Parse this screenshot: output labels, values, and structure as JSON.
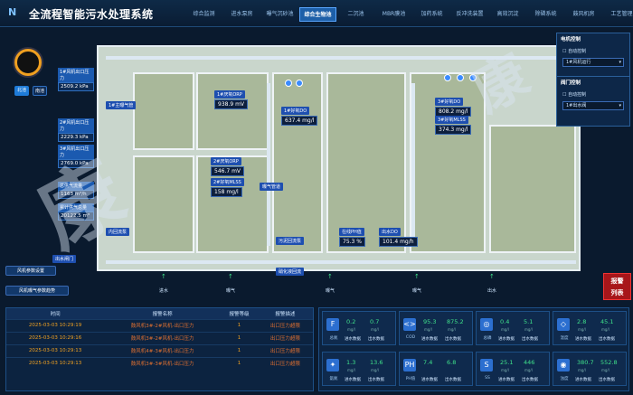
{
  "header": {
    "title": "全流程智能污水处理系统"
  },
  "tabs": [
    "综合监测",
    "进水泵房",
    "曝气沉砂池",
    "综合生物池",
    "二沉池",
    "MBR膜池",
    "加药系统",
    "反冲洗装置",
    "高效沉淀",
    "除磷系统",
    "鼓风机房",
    "工艺管理"
  ],
  "active_tab": 3,
  "gauge_labels": {
    "north": "北池",
    "south": "南池"
  },
  "left_readouts": [
    {
      "key": "1#风机出口压力",
      "value": "2509.2 kPa"
    },
    {
      "key": "2#风机出口压力",
      "value": "2229.3 kPa"
    },
    {
      "key": "3#风机出口压力",
      "value": "2769.0 kPa"
    },
    {
      "key": "总供气流量",
      "value": "1163 m³/h"
    },
    {
      "key": "累计供气总量",
      "value": "20122.5 m³"
    }
  ],
  "left_buttons": {
    "setting": "风机参数设置",
    "curve": "风机曝气参数趋势"
  },
  "inlet_label": "进水",
  "inlet_tag": "出水闸门",
  "outlet_tags": [
    "曝气",
    "曝气",
    "曝气",
    "出水"
  ],
  "plant_labels": {
    "aer1": "1#主曝气管",
    "do_a": "1#好氧DO",
    "orp_a": "1#厌氧ORP",
    "mlss_a": "1#好氧MLSS",
    "orp_b": "2#厌氧ORP",
    "mlss_b": "2#好氧MLSS",
    "do_mid": "2#好氧DO",
    "do_r": "3#好氧DO",
    "mlss_r": "3#好氧MLSS",
    "sludge": "污泥回流泵",
    "inner": "内回流泵",
    "nitro": "硝化液回流",
    "ph": "在线PH值",
    "outletdo": "出水DO",
    "tank_mid": "生物反应池 A/O区",
    "aerate": "曝气管道"
  },
  "plant_values": {
    "orp_a": "938.9 mV",
    "do_a": "637.4 mg/l",
    "mlss_a": "546.7 mV",
    "mlss_a2": "158 mg/l",
    "do_r": "808.2 mg/l",
    "mlss_r": "374.3 mg/l",
    "ph": "75.3 %",
    "outletdo": "101.4 mg/h"
  },
  "control_panels": [
    {
      "title": "电机控制",
      "checkbox": "自动控制",
      "select": "1#风机运行"
    },
    {
      "title": "阀门控制",
      "checkbox": "自动控制",
      "select": "1#出水阀"
    }
  ],
  "alarm_button": "报警\n列表",
  "alarm_table": {
    "headers": [
      "时间",
      "报警名称",
      "报警等级",
      "报警描述"
    ],
    "rows": [
      [
        "2025-03-03 10:29:19",
        "鼓风机3#-2#风机-出口压力",
        "1",
        "出口压力超限"
      ],
      [
        "2025-03-03 10:29:16",
        "鼓风机3#-2#风机-出口压力",
        "1",
        "出口压力超限"
      ],
      [
        "2025-03-03 10:29:13",
        "鼓风机4#-3#风机-出口压力",
        "1",
        "出口压力超限"
      ],
      [
        "2025-03-03 10:29:13",
        "鼓风机3#-3#风机-出口压力",
        "1",
        "出口压力超限"
      ]
    ]
  },
  "monitors": [
    {
      "icon": "F",
      "name": "总氮",
      "v1": "0.2",
      "u1": "mg/l",
      "v2": "0.7",
      "u2": "mg/l",
      "s1": "进水数据",
      "s2": "出水数据"
    },
    {
      "icon": "<>",
      "name": "COD",
      "v1": "95.3",
      "u1": "mg/l",
      "v2": "875.2",
      "u2": "mg/l",
      "s1": "进水数据",
      "s2": "出水数据"
    },
    {
      "icon": "◎",
      "name": "总磷",
      "v1": "0.4",
      "u1": "mg/l",
      "v2": "5.1",
      "u2": "mg/l",
      "s1": "进水数据",
      "s2": "出水数据"
    },
    {
      "icon": "◇",
      "name": "温度",
      "v1": "2.8",
      "u1": "mg/l",
      "v2": "45.1",
      "u2": "mg/l",
      "s1": "进水数据",
      "s2": "出水数据"
    },
    {
      "icon": "✦",
      "name": "氨氮",
      "v1": "1.3",
      "u1": "mg/l",
      "v2": "13.6",
      "u2": "mg/l",
      "s1": "进水数据",
      "s2": "出水数据"
    },
    {
      "icon": "PH",
      "name": "PH值",
      "v1": "7.4",
      "u1": "",
      "v2": "6.8",
      "u2": "",
      "s1": "进水数据",
      "s2": "出水数据"
    },
    {
      "icon": "S",
      "name": "SS",
      "v1": "25.1",
      "u1": "mg/l",
      "v2": "446",
      "u2": "mg/l",
      "s1": "进水数据",
      "s2": "出水数据"
    },
    {
      "icon": "◉",
      "name": "浊度",
      "v1": "380.7",
      "u1": "mg/l",
      "v2": "552.8",
      "u2": "mg/l",
      "s1": "进水数据",
      "s2": "出水数据"
    }
  ],
  "colors": {
    "accent": "#1d5fa8",
    "alarm": "#a8161a",
    "good": "#3fe08a"
  }
}
